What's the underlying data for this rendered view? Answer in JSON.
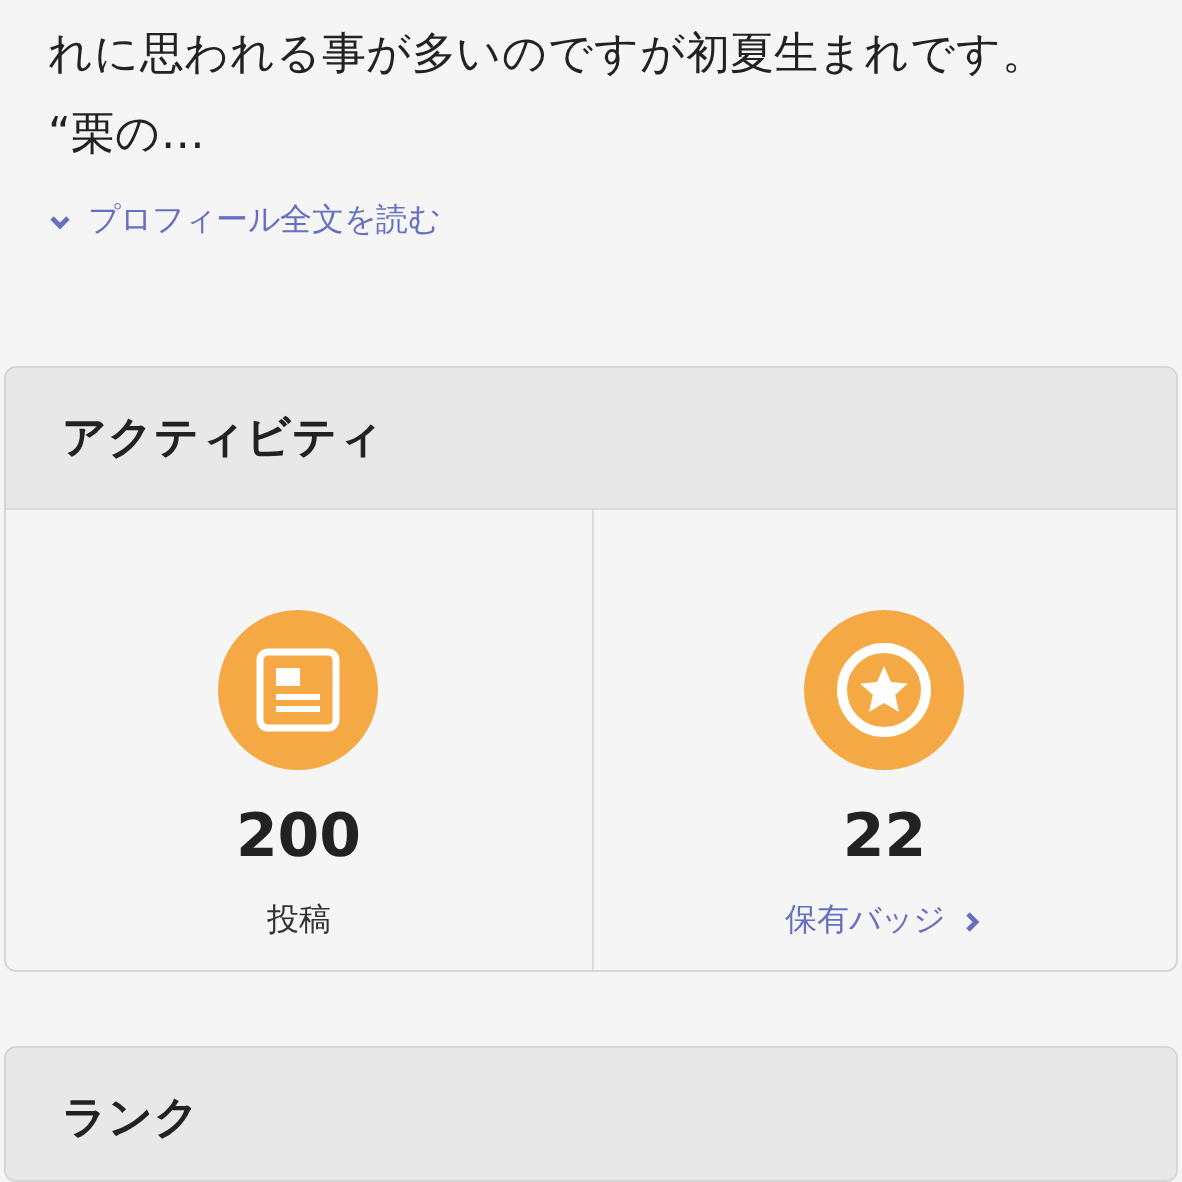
{
  "profile": {
    "text_lines": [
      "れに思われる事が多いのですが初夏生まれです。",
      "“栗の…"
    ],
    "read_more": "プロフィール全文を読む"
  },
  "activity": {
    "title": "アクティビティ",
    "stats": [
      {
        "kind": "posts",
        "value": "200",
        "label": "投稿",
        "link": false
      },
      {
        "kind": "badges",
        "value": "22",
        "label": "保有バッジ",
        "link": true
      }
    ]
  },
  "rank": {
    "title": "ランク"
  }
}
